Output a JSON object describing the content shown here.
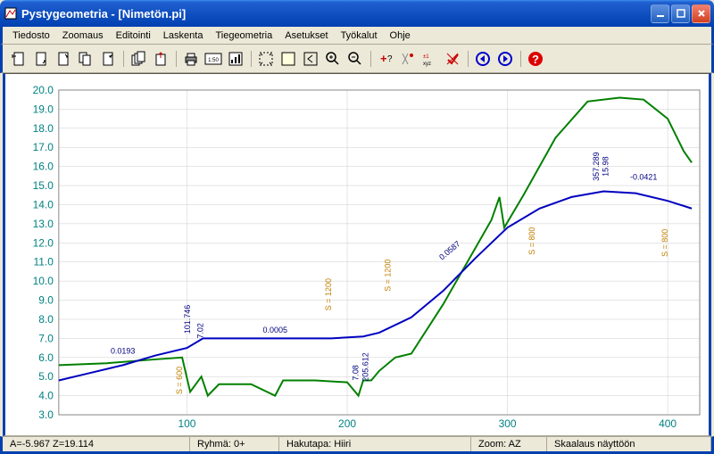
{
  "window": {
    "title": "Pystygeometria - [Nimetön.pi]"
  },
  "menu": {
    "items": [
      "Tiedosto",
      "Zoomaus",
      "Editointi",
      "Laskenta",
      "Tiegeometria",
      "Asetukset",
      "Työkalut",
      "Ohje"
    ]
  },
  "status": {
    "coords": "A=-5.967  Z=19.114",
    "group": "Ryhmä: 0+",
    "search": "Hakutapa: Hiiri",
    "zoom": "Zoom: AZ",
    "scale": "Skaalaus näyttöön"
  },
  "chart_data": {
    "type": "line",
    "xlabel": "",
    "ylabel": "",
    "xlim": [
      20,
      420
    ],
    "ylim": [
      3,
      20
    ],
    "xticks": [
      100,
      200,
      300,
      400
    ],
    "yticks": [
      3.0,
      4.0,
      5.0,
      6.0,
      7.0,
      8.0,
      9.0,
      10.0,
      11.0,
      12.0,
      13.0,
      14.0,
      15.0,
      16.0,
      17.0,
      18.0,
      19.0,
      20.0
    ],
    "series": [
      {
        "name": "green",
        "color": "#008000",
        "points": [
          [
            20,
            5.6
          ],
          [
            50,
            5.7
          ],
          [
            80,
            5.9
          ],
          [
            97,
            6.0
          ],
          [
            102,
            4.2
          ],
          [
            109,
            5.0
          ],
          [
            113,
            4.0
          ],
          [
            120,
            4.6
          ],
          [
            140,
            4.6
          ],
          [
            155,
            4.0
          ],
          [
            160,
            4.8
          ],
          [
            180,
            4.8
          ],
          [
            200,
            4.7
          ],
          [
            207,
            4.0
          ],
          [
            210,
            4.8
          ],
          [
            215,
            4.8
          ],
          [
            220,
            5.3
          ],
          [
            230,
            6.0
          ],
          [
            240,
            6.2
          ],
          [
            260,
            8.8
          ],
          [
            275,
            11.0
          ],
          [
            290,
            13.2
          ],
          [
            295,
            14.4
          ],
          [
            298,
            12.8
          ],
          [
            310,
            14.5
          ],
          [
            330,
            17.5
          ],
          [
            350,
            19.4
          ],
          [
            370,
            19.6
          ],
          [
            385,
            19.5
          ],
          [
            400,
            18.5
          ],
          [
            410,
            16.8
          ],
          [
            415,
            16.2
          ]
        ]
      },
      {
        "name": "blue",
        "color": "#0000c0",
        "points": [
          [
            20,
            4.8
          ],
          [
            40,
            5.2
          ],
          [
            60,
            5.6
          ],
          [
            80,
            6.1
          ],
          [
            100,
            6.5
          ],
          [
            110,
            7.0
          ],
          [
            130,
            7.0
          ],
          [
            160,
            7.0
          ],
          [
            190,
            7.0
          ],
          [
            210,
            7.1
          ],
          [
            220,
            7.3
          ],
          [
            240,
            8.1
          ],
          [
            260,
            9.5
          ],
          [
            280,
            11.2
          ],
          [
            300,
            12.8
          ],
          [
            320,
            13.8
          ],
          [
            340,
            14.4
          ],
          [
            360,
            14.7
          ],
          [
            380,
            14.6
          ],
          [
            400,
            14.2
          ],
          [
            415,
            13.8
          ]
        ]
      }
    ],
    "annotations": [
      {
        "x": 60,
        "y": 6.2,
        "text": "0.0193",
        "rot": 0
      },
      {
        "x": 102,
        "y": 8.0,
        "text": "101.746",
        "rot": -90
      },
      {
        "x": 110,
        "y": 7.4,
        "text": "7.02",
        "rot": -90
      },
      {
        "x": 97,
        "y": 4.8,
        "text": "S = 600",
        "rot": -90,
        "color": "#c08000"
      },
      {
        "x": 155,
        "y": 7.3,
        "text": "0.0005",
        "rot": 0
      },
      {
        "x": 190,
        "y": 9.3,
        "text": "S = 1200",
        "rot": -90,
        "color": "#c08000"
      },
      {
        "x": 207,
        "y": 5.2,
        "text": "7.08",
        "rot": -90
      },
      {
        "x": 213,
        "y": 5.5,
        "text": "205.612",
        "rot": -90
      },
      {
        "x": 227,
        "y": 10.3,
        "text": "S = 1200",
        "rot": -90,
        "color": "#c08000"
      },
      {
        "x": 265,
        "y": 11.5,
        "text": "0.0587",
        "rot": -40
      },
      {
        "x": 317,
        "y": 12.1,
        "text": "S = 800",
        "rot": -90,
        "color": "#c08000"
      },
      {
        "x": 357,
        "y": 16.0,
        "text": "357.289",
        "rot": -90
      },
      {
        "x": 363,
        "y": 16.0,
        "text": "15.98",
        "rot": -90
      },
      {
        "x": 385,
        "y": 15.3,
        "text": "-0.0421",
        "rot": 0
      },
      {
        "x": 400,
        "y": 12.0,
        "text": "S = 800",
        "rot": -90,
        "color": "#c08000"
      }
    ]
  }
}
